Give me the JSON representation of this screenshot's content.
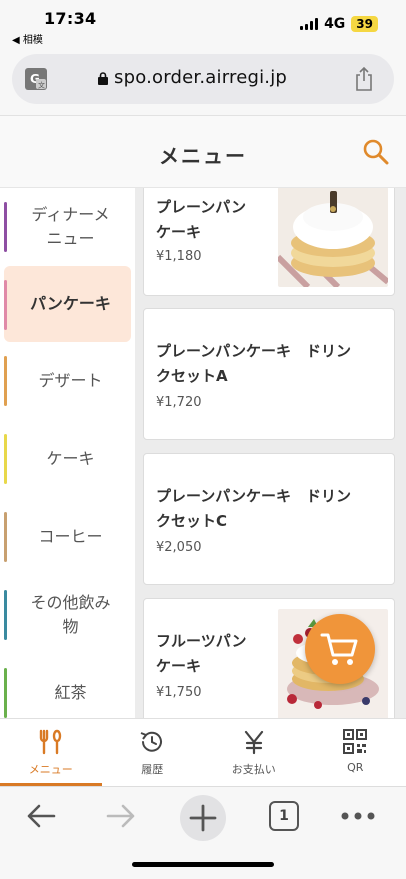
{
  "status": {
    "time": "17:34",
    "back_label": "◀ 相模",
    "network": "4G",
    "battery": "39"
  },
  "browser": {
    "url": "spo.order.airregi.jp",
    "tab_count": "1"
  },
  "header": {
    "title": "メニュー"
  },
  "categories": [
    {
      "label": "ディナーメニュー",
      "color": "#8e4fa3"
    },
    {
      "label": "パンケーキ",
      "color": "#e08aa8",
      "active": true
    },
    {
      "label": "デザート",
      "color": "#e0a050"
    },
    {
      "label": "ケーキ",
      "color": "#e8d84a"
    },
    {
      "label": "コーヒー",
      "color": "#c8a070"
    },
    {
      "label": "その他飲み物",
      "color": "#3a8aa0"
    },
    {
      "label": "紅茶",
      "color": "#6ab04c"
    }
  ],
  "items": [
    {
      "name_line1": "プレーンパン",
      "name_line2": "ケーキ",
      "price": "¥1,180",
      "image": "pancake-photo"
    },
    {
      "name_line1": "プレーンパンケーキ　ドリン",
      "name_line2": "クセットA",
      "price": "¥1,720"
    },
    {
      "name_line1": "プレーンパンケーキ　ドリン",
      "name_line2": "クセットC",
      "price": "¥2,050"
    },
    {
      "name_line1": "フルーツパン",
      "name_line2": "ケーキ",
      "price": "¥1,750",
      "image": "fruit-pancake-photo"
    }
  ],
  "tabs": [
    {
      "label": "メニュー",
      "icon": "fork-knife-icon",
      "active": true
    },
    {
      "label": "履歴",
      "icon": "history-icon"
    },
    {
      "label": "お支払い",
      "icon": "yen-icon"
    },
    {
      "label": "QR",
      "icon": "qr-code-icon"
    }
  ],
  "colors": {
    "accent": "#d97a25",
    "cart": "#f0953a",
    "active_category_bg": "#fde7d9"
  }
}
